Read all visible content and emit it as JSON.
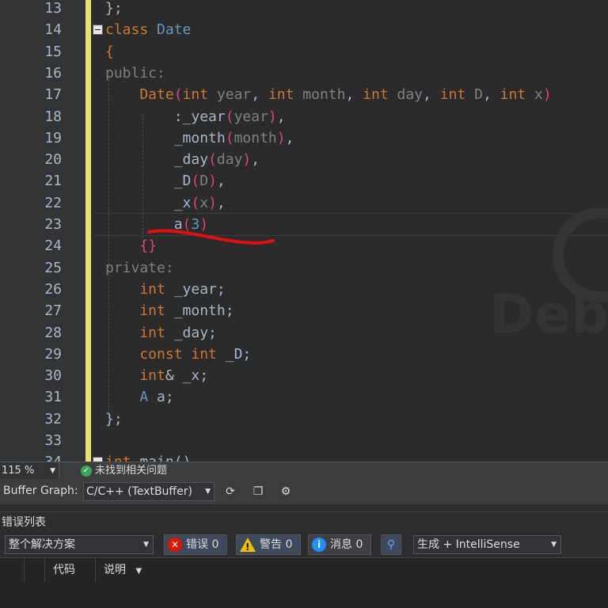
{
  "editor": {
    "lines": [
      {
        "n": "13",
        "tokens": [
          {
            "t": "};",
            "c": ""
          }
        ]
      },
      {
        "n": "14",
        "fold": true,
        "tokens": [
          {
            "t": "class ",
            "c": "kw"
          },
          {
            "t": "Date",
            "c": "cls"
          }
        ]
      },
      {
        "n": "15",
        "tokens": [
          {
            "t": "{",
            "c": "kw"
          }
        ]
      },
      {
        "n": "16",
        "tokens": [
          {
            "t": "public",
            "c": "dim"
          },
          {
            "t": ":",
            "c": "dim"
          }
        ]
      },
      {
        "n": "17",
        "tokens": [
          {
            "t": "    Date",
            "c": "kw"
          },
          {
            "t": "(",
            "c": "pink"
          },
          {
            "t": "int",
            "c": "kw"
          },
          {
            "t": " year",
            "c": "param"
          },
          {
            "t": ", ",
            "c": ""
          },
          {
            "t": "int",
            "c": "kw"
          },
          {
            "t": " month",
            "c": "param"
          },
          {
            "t": ", ",
            "c": ""
          },
          {
            "t": "int",
            "c": "kw"
          },
          {
            "t": " day",
            "c": "param"
          },
          {
            "t": ", ",
            "c": ""
          },
          {
            "t": "int",
            "c": "kw"
          },
          {
            "t": " D",
            "c": "param"
          },
          {
            "t": ", ",
            "c": ""
          },
          {
            "t": "int",
            "c": "kw"
          },
          {
            "t": " x",
            "c": "param"
          },
          {
            "t": ")",
            "c": "pink"
          }
        ]
      },
      {
        "n": "18",
        "tokens": [
          {
            "t": "        :_year",
            "c": ""
          },
          {
            "t": "(",
            "c": "pink"
          },
          {
            "t": "year",
            "c": "param"
          },
          {
            "t": ")",
            "c": "pink"
          },
          {
            "t": ",",
            "c": ""
          }
        ]
      },
      {
        "n": "19",
        "tokens": [
          {
            "t": "        _month",
            "c": ""
          },
          {
            "t": "(",
            "c": "pink"
          },
          {
            "t": "month",
            "c": "param"
          },
          {
            "t": ")",
            "c": "pink"
          },
          {
            "t": ",",
            "c": ""
          }
        ]
      },
      {
        "n": "20",
        "tokens": [
          {
            "t": "        _day",
            "c": ""
          },
          {
            "t": "(",
            "c": "pink"
          },
          {
            "t": "day",
            "c": "param"
          },
          {
            "t": ")",
            "c": "pink"
          },
          {
            "t": ",",
            "c": ""
          }
        ]
      },
      {
        "n": "21",
        "tokens": [
          {
            "t": "        _D",
            "c": ""
          },
          {
            "t": "(",
            "c": "pink"
          },
          {
            "t": "D",
            "c": "param"
          },
          {
            "t": ")",
            "c": "pink"
          },
          {
            "t": ",",
            "c": ""
          }
        ]
      },
      {
        "n": "22",
        "tokens": [
          {
            "t": "        _x",
            "c": ""
          },
          {
            "t": "(",
            "c": "pink"
          },
          {
            "t": "x",
            "c": "param"
          },
          {
            "t": ")",
            "c": "pink"
          },
          {
            "t": ",",
            "c": ""
          }
        ]
      },
      {
        "n": "23",
        "tokens": [
          {
            "t": "        a",
            "c": ""
          },
          {
            "t": "(",
            "c": "pink"
          },
          {
            "t": "3",
            "c": "cls"
          },
          {
            "t": ")",
            "c": "pink"
          }
        ]
      },
      {
        "n": "24",
        "tokens": [
          {
            "t": "    {}",
            "c": "pink"
          }
        ]
      },
      {
        "n": "25",
        "tokens": [
          {
            "t": "private",
            "c": "dim"
          },
          {
            "t": ":",
            "c": "dim"
          }
        ]
      },
      {
        "n": "26",
        "tokens": [
          {
            "t": "    int",
            "c": "kw"
          },
          {
            "t": " _year;",
            "c": ""
          }
        ]
      },
      {
        "n": "27",
        "tokens": [
          {
            "t": "    int",
            "c": "kw"
          },
          {
            "t": " _month;",
            "c": ""
          }
        ]
      },
      {
        "n": "28",
        "tokens": [
          {
            "t": "    int",
            "c": "kw"
          },
          {
            "t": " _day;",
            "c": ""
          }
        ]
      },
      {
        "n": "29",
        "tokens": [
          {
            "t": "    const int",
            "c": "kw"
          },
          {
            "t": " _D;",
            "c": ""
          }
        ]
      },
      {
        "n": "30",
        "tokens": [
          {
            "t": "    int",
            "c": "kw"
          },
          {
            "t": "& _x;",
            "c": ""
          }
        ]
      },
      {
        "n": "31",
        "tokens": [
          {
            "t": "    A",
            "c": "cls"
          },
          {
            "t": " a;",
            "c": ""
          }
        ]
      },
      {
        "n": "32",
        "tokens": [
          {
            "t": "};",
            "c": ""
          }
        ]
      },
      {
        "n": "33",
        "tokens": []
      },
      {
        "n": "34",
        "fold": true,
        "tokens": [
          {
            "t": "int ",
            "c": "kw"
          },
          {
            "t": "main()",
            "c": ""
          }
        ]
      }
    ],
    "watermark": "Debi"
  },
  "statusbar": {
    "zoom": "115 %",
    "issues": "未找到相关问题"
  },
  "bufferbar": {
    "label": "Buffer Graph:",
    "selected": "C/C++ (TextBuffer)"
  },
  "errorlist": {
    "title": "错误列表",
    "scope": "整个解决方案",
    "errors_label": "错误",
    "errors_count": "0",
    "warnings_label": "警告",
    "warnings_count": "0",
    "messages_label": "消息",
    "messages_count": "0",
    "build_source": "生成 + IntelliSense",
    "col_code": "代码",
    "col_desc": "说明"
  },
  "colors": {
    "keyword": "#cc7832",
    "paren": "#e0457b",
    "number": "#6897bb",
    "change_bar": "#e8e070",
    "annotation": "#e01010"
  }
}
